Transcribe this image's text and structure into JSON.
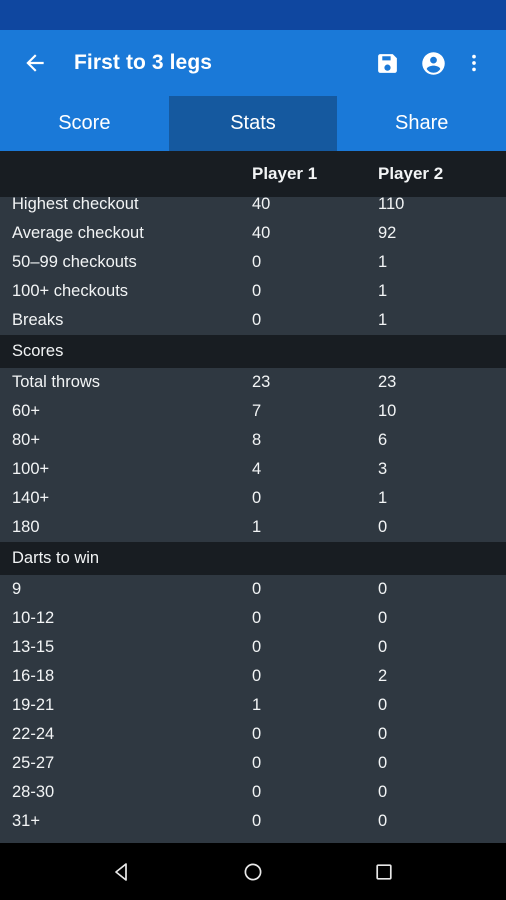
{
  "status_bar": {
    "background": "#0f47a0"
  },
  "toolbar": {
    "back_label": "Back",
    "title": "First to 3 legs",
    "background": "#1a79d8",
    "actions": [
      {
        "name": "save-icon",
        "label": "Save"
      },
      {
        "name": "account-icon",
        "label": "Account"
      },
      {
        "name": "overflow-menu-icon",
        "label": "More options"
      }
    ]
  },
  "tabs": {
    "selected": "Stats",
    "selected_background": "#15599f",
    "items": [
      {
        "label": "Score"
      },
      {
        "label": "Stats"
      },
      {
        "label": "Share"
      }
    ]
  },
  "table": {
    "header_background": "#181d22",
    "row_background": "#2f3841",
    "columns": [
      "",
      "Player 1",
      "Player 2"
    ],
    "rows": [
      {
        "type": "data",
        "label": "Highest checkout",
        "p1": "40",
        "p2": "110"
      },
      {
        "type": "data",
        "label": "Average checkout",
        "p1": "40",
        "p2": "92"
      },
      {
        "type": "data",
        "label": "50–99 checkouts",
        "p1": "0",
        "p2": "1"
      },
      {
        "type": "data",
        "label": "100+ checkouts",
        "p1": "0",
        "p2": "1"
      },
      {
        "type": "data",
        "label": "Breaks",
        "p1": "0",
        "p2": "1"
      },
      {
        "type": "section",
        "label": "Scores",
        "p1": "",
        "p2": ""
      },
      {
        "type": "data",
        "label": "Total throws",
        "p1": "23",
        "p2": "23"
      },
      {
        "type": "data",
        "label": "60+",
        "p1": "7",
        "p2": "10"
      },
      {
        "type": "data",
        "label": "80+",
        "p1": "8",
        "p2": "6"
      },
      {
        "type": "data",
        "label": "100+",
        "p1": "4",
        "p2": "3"
      },
      {
        "type": "data",
        "label": "140+",
        "p1": "0",
        "p2": "1"
      },
      {
        "type": "data",
        "label": "180",
        "p1": "1",
        "p2": "0"
      },
      {
        "type": "section",
        "label": "Darts to win",
        "p1": "",
        "p2": ""
      },
      {
        "type": "data",
        "label": "9",
        "p1": "0",
        "p2": "0"
      },
      {
        "type": "data",
        "label": "10-12",
        "p1": "0",
        "p2": "0"
      },
      {
        "type": "data",
        "label": "13-15",
        "p1": "0",
        "p2": "0"
      },
      {
        "type": "data",
        "label": "16-18",
        "p1": "0",
        "p2": "2"
      },
      {
        "type": "data",
        "label": "19-21",
        "p1": "1",
        "p2": "0"
      },
      {
        "type": "data",
        "label": "22-24",
        "p1": "0",
        "p2": "0"
      },
      {
        "type": "data",
        "label": "25-27",
        "p1": "0",
        "p2": "0"
      },
      {
        "type": "data",
        "label": "28-30",
        "p1": "0",
        "p2": "0"
      },
      {
        "type": "data",
        "label": "31+",
        "p1": "0",
        "p2": "0"
      }
    ]
  },
  "nav_bar": {
    "buttons": [
      {
        "name": "nav-back-icon",
        "label": "Back"
      },
      {
        "name": "nav-home-icon",
        "label": "Home"
      },
      {
        "name": "nav-recents-icon",
        "label": "Recents"
      }
    ]
  }
}
